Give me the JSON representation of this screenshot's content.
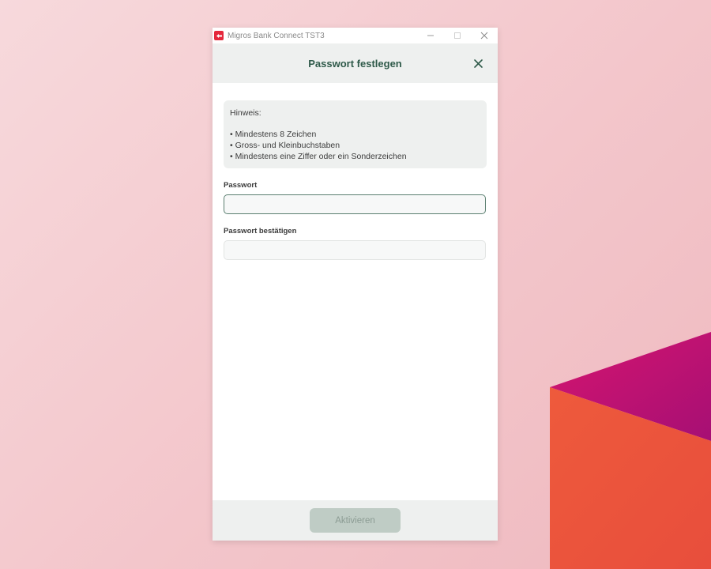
{
  "window": {
    "app_title": "Migros Bank Connect TST3",
    "controls": [
      "minimize-icon",
      "maximize-icon",
      "close-icon"
    ]
  },
  "dialog": {
    "title": "Passwort festlegen",
    "close_icon": "close-icon",
    "hint": {
      "title": "Hinweis:",
      "items": [
        "Mindestens 8 Zeichen",
        "Gross- und Kleinbuchstaben",
        "Mindestens eine Ziffer oder ein Sonderzeichen"
      ]
    },
    "password": {
      "label": "Passwort",
      "value": "",
      "placeholder": ""
    },
    "password_confirm": {
      "label": "Passwort bestätigen",
      "value": "",
      "placeholder": ""
    },
    "submit_label": "Aktivieren"
  },
  "colors": {
    "accent": "#2f5a4a",
    "brand": "#e5283c",
    "disabled_button": "#bfccc5"
  }
}
